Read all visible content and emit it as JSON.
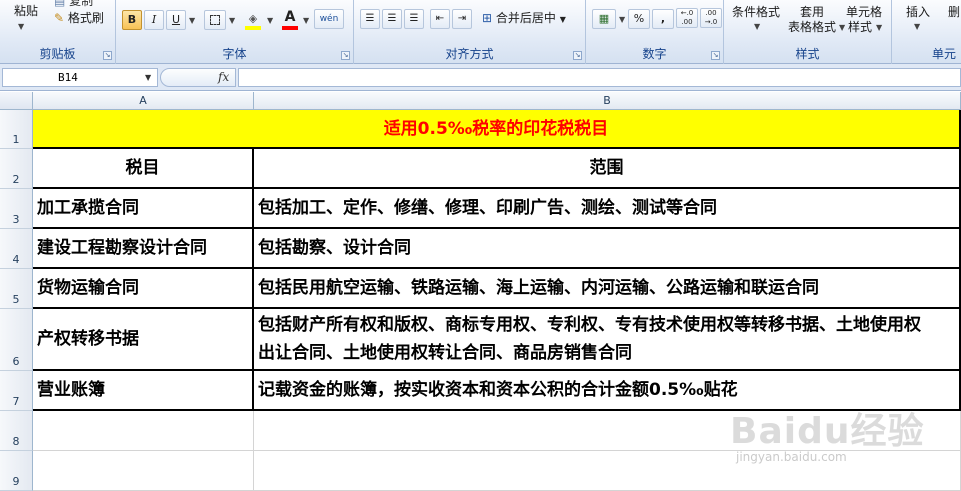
{
  "ribbon": {
    "clipboard": {
      "paste_label": "粘贴",
      "copy_label": "复制",
      "format_painter_label": "格式刷",
      "group_label": "剪贴板"
    },
    "font": {
      "bold": "B",
      "italic": "I",
      "underline": "U",
      "font_color_letter": "A",
      "phonetic": "wén",
      "group_label": "字体"
    },
    "alignment": {
      "merge_label": "合并后居中",
      "group_label": "对齐方式"
    },
    "number": {
      "percent": "%",
      "comma": ",",
      "inc_decimal": "←.0 .00",
      "dec_decimal": ".00 →.0",
      "group_label": "数字"
    },
    "styles": {
      "conditional_label": "条件格式",
      "apply_label": "套用",
      "table_format_label": "表格格式",
      "cell_label": "单元格",
      "style_label": "样式",
      "group_label": "样式"
    },
    "cells": {
      "insert_label": "插入",
      "delete_label": "删",
      "group_label": "单元"
    }
  },
  "formula_bar": {
    "name_box": "B14",
    "fx": "fx",
    "formula": ""
  },
  "columns": [
    "A",
    "B"
  ],
  "rows": [
    {
      "num": "1",
      "a": "适用0.5‰税率的印花税税目",
      "b": ""
    },
    {
      "num": "2",
      "a": "税目",
      "b": "范围"
    },
    {
      "num": "3",
      "a": "加工承揽合同",
      "b": "包括加工、定作、修缮、修理、印刷广告、测绘、测试等合同"
    },
    {
      "num": "4",
      "a": "建设工程勘察设计合同",
      "b": "包括勘察、设计合同"
    },
    {
      "num": "5",
      "a": "货物运输合同",
      "b": "包括民用航空运输、铁路运输、海上运输、内河运输、公路运输和联运合同"
    },
    {
      "num": "6",
      "a": "产权转移书据",
      "b": "包括财产所有权和版权、商标专用权、专利权、专有技术使用权等转移书据、土地使用权出让合同、土地使用权转让合同、商品房销售合同"
    },
    {
      "num": "7",
      "a": "营业账簿",
      "b": "记载资金的账簿，按实收资本和资本公积的合计金额0.5‰贴花"
    },
    {
      "num": "8",
      "a": "",
      "b": ""
    },
    {
      "num": "9",
      "a": "",
      "b": ""
    }
  ],
  "watermark": {
    "text": "Baidu经验",
    "sub": "jingyan.baidu.com"
  },
  "colors": {
    "title_bg": "#ffff00",
    "title_fg": "#ff0000",
    "ribbon_label": "#15428b"
  }
}
